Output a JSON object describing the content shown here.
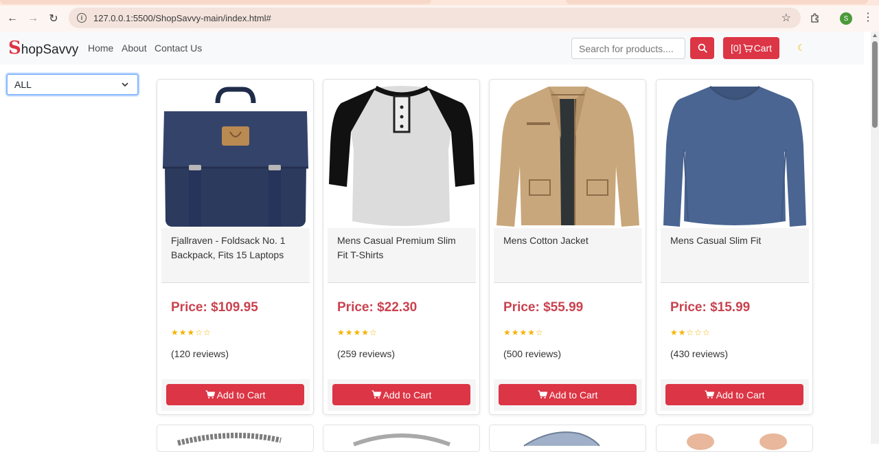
{
  "browser": {
    "url": "127.0.0.1:5500/ShopSavvy-main/index.html#",
    "profile_initial": "S"
  },
  "navbar": {
    "brand_initial": "S",
    "brand_rest": "hopSavvy",
    "links": [
      "Home",
      "About",
      "Contact Us"
    ],
    "search_placeholder": "Search for products....",
    "cart_count": "[0]",
    "cart_label": "Cart"
  },
  "filter": {
    "selected": "ALL"
  },
  "products": [
    {
      "title": "Fjallraven - Foldsack No. 1 Backpack, Fits 15 Laptops",
      "price": "Price: $109.95",
      "rating": 3,
      "reviews": "(120 reviews)",
      "button": "Add to Cart"
    },
    {
      "title": "Mens Casual Premium Slim Fit T-Shirts",
      "price": "Price: $22.30",
      "rating": 4,
      "reviews": "(259 reviews)",
      "button": "Add to Cart"
    },
    {
      "title": "Mens Cotton Jacket",
      "price": "Price: $55.99",
      "rating": 4,
      "reviews": "(500 reviews)",
      "button": "Add to Cart"
    },
    {
      "title": "Mens Casual Slim Fit",
      "price": "Price: $15.99",
      "rating": 2,
      "reviews": "(430 reviews)",
      "button": "Add to Cart"
    }
  ],
  "colors": {
    "accent": "#dc3545",
    "price": "#c9424f",
    "star": "#f5b301"
  }
}
